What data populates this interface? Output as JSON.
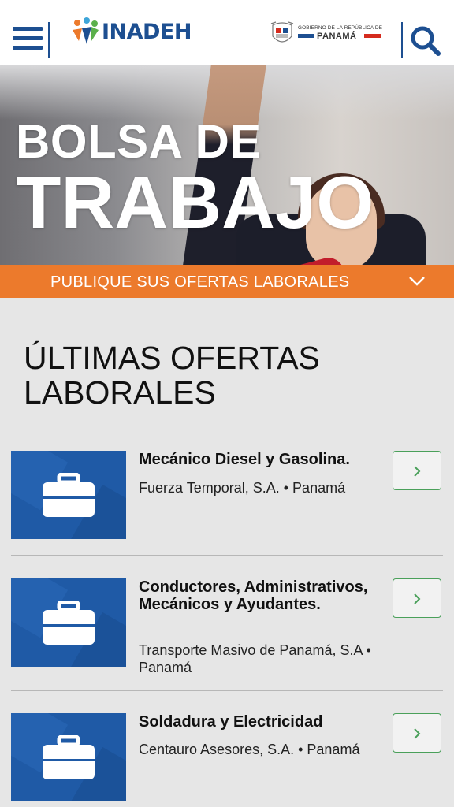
{
  "header": {
    "logo_text": "INADEH",
    "gov_line1": "GOBIERNO DE LA REPÚBLICA DE",
    "gov_line2": "PANAMÁ"
  },
  "hero": {
    "title_line1": "BOLSA DE",
    "title_line2": "TRABAJO"
  },
  "cta": {
    "label": "PUBLIQUE SUS OFERTAS LABORALES"
  },
  "section": {
    "title": "ÚLTIMAS OFERTAS LABORALES"
  },
  "jobs": [
    {
      "title": "Mecánico Diesel y Gasolina.",
      "company": "Fuerza Temporal, S.A. • Panamá"
    },
    {
      "title": "Conductores, Administrativos, Mecánicos y Ayudantes.",
      "company": "Transporte Masivo de Panamá, S.A • Panamá"
    },
    {
      "title": "Soldadura y Electricidad",
      "company": "Centauro Asesores, S.A. • Panamá"
    }
  ],
  "colors": {
    "brand_blue": "#1d4f91",
    "accent_orange": "#ec7a2c",
    "button_green": "#4aa05a",
    "job_image_blue": "#1f5aa6"
  },
  "icons": {
    "menu": "hamburger-menu-icon",
    "search": "search-icon",
    "chevron_down": "chevron-down-icon",
    "briefcase": "briefcase-icon",
    "chevron_right": "chevron-right-icon",
    "gov_seal": "coat-of-arms-icon"
  }
}
